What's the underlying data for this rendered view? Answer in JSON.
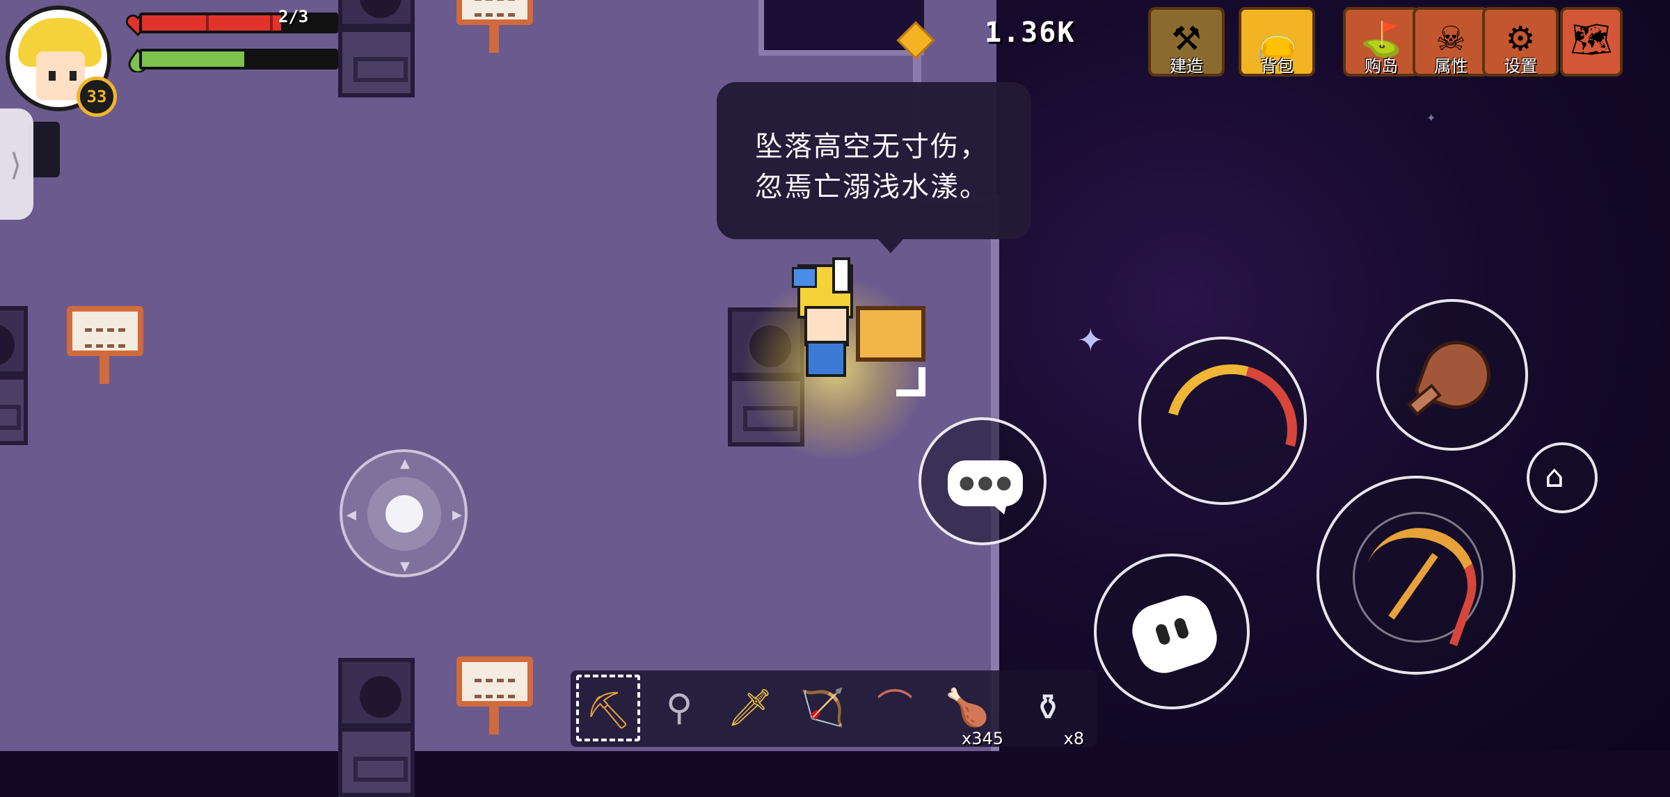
{
  "hud": {
    "level": "33",
    "hp_text": "2/3",
    "hp_fraction": 0.72,
    "mp_fraction": 0.53,
    "coins": "1.36K"
  },
  "menu": {
    "build": "建造",
    "bag": "背包",
    "buy_island": "购岛",
    "attributes": "属性",
    "settings": "设置"
  },
  "speech": {
    "line1": "坠落高空无寸伤，",
    "line2": "忽焉亡溺浅水漾。"
  },
  "hotbar": {
    "slots": [
      {
        "icon": "pickaxe-icon",
        "count": ""
      },
      {
        "icon": "shovel-icon",
        "count": ""
      },
      {
        "icon": "sword-icon",
        "count": ""
      },
      {
        "icon": "bow-icon",
        "count": ""
      },
      {
        "icon": "fishing-rod-icon",
        "count": ""
      },
      {
        "icon": "meat-icon",
        "count": "x345"
      },
      {
        "icon": "bottle-icon",
        "count": "x8"
      }
    ]
  },
  "colors": {
    "floor": "#6b5a8e",
    "space": "#160a2c",
    "hp": "#e1332c",
    "mp": "#7cc44c",
    "accent_gold": "#f2b423"
  }
}
